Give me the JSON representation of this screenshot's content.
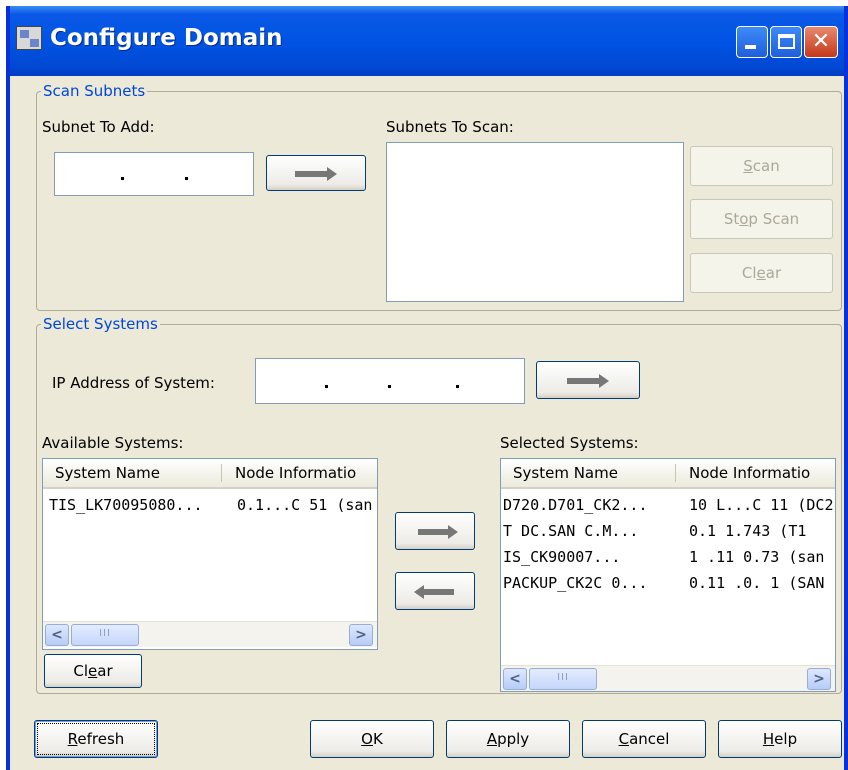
{
  "window": {
    "title": "Configure Domain",
    "close_glyph": "✕"
  },
  "scan_subnets": {
    "legend": "Scan Subnets",
    "subnet_to_add_label": "Subnet To Add:",
    "subnets_to_scan_label": "Subnets To Scan:",
    "scan_button": {
      "pre": "",
      "u": "S",
      "post": "can"
    },
    "stop_scan_button": {
      "pre": "St",
      "u": "o",
      "post": "p Scan"
    },
    "clear_button": {
      "pre": "Cl",
      "u": "e",
      "post": "ar"
    }
  },
  "select_systems": {
    "legend": "Select Systems",
    "ip_label": "IP Address of System:",
    "available_label": "Available Systems:",
    "selected_label": "Selected Systems:",
    "columns": [
      "System Name",
      "Node Informatio"
    ],
    "available_rows": [
      [
        "TIS_LK70095080...",
        "0.1...C 51 (san"
      ]
    ],
    "selected_rows": [
      [
        "D720.D701_CK2...",
        "10 L...C 11 (DC2"
      ],
      [
        "T DC.SAN  C.M...",
        "0.1  1.743 (T1"
      ],
      [
        "   IS_CK90007...",
        "1 .11  0.73 (san"
      ],
      [
        "PACKUP_CK2C 0...",
        "0.11 .0. 1 (SAN"
      ]
    ],
    "clear_button": {
      "pre": "Cl",
      "u": "e",
      "post": "ar"
    },
    "scroll_left_glyph": "<",
    "scroll_right_glyph": ">",
    "thumb_grip": "III"
  },
  "footer": {
    "refresh_button": {
      "pre": "",
      "u": "R",
      "post": "efresh"
    },
    "ok_button": {
      "pre": "",
      "u": "O",
      "post": "K"
    },
    "apply_button": {
      "pre": "",
      "u": "A",
      "post": "pply"
    },
    "cancel_button": {
      "pre": "",
      "u": "C",
      "post": "ancel"
    },
    "help_button": {
      "pre": "",
      "u": "H",
      "post": "elp"
    }
  },
  "icons": [
    "app-icon",
    "minimize-icon",
    "maximize-icon",
    "close-icon",
    "arrow-right-icon",
    "arrow-left-icon",
    "scroll-left-icon",
    "scroll-right-icon"
  ]
}
